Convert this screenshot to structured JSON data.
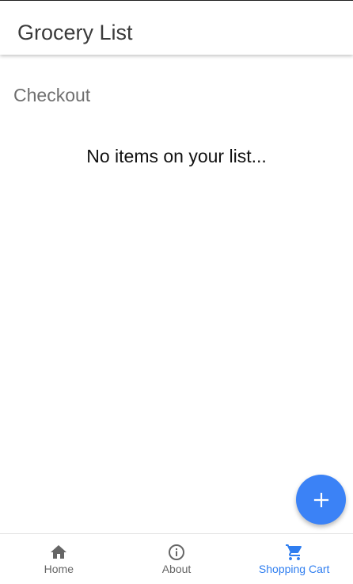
{
  "app_bar": {
    "title": "Grocery List"
  },
  "main": {
    "section_title": "Checkout",
    "empty_message": "No items on your list..."
  },
  "fab": {
    "icon": "plus-icon",
    "color": "#3b82f6"
  },
  "bottom_nav": {
    "active": "Shopping Cart",
    "accent_color": "#2f7ef0",
    "items": [
      {
        "label": "Home",
        "icon": "home-icon"
      },
      {
        "label": "About",
        "icon": "info-icon"
      },
      {
        "label": "Shopping Cart",
        "icon": "cart-icon"
      }
    ]
  }
}
